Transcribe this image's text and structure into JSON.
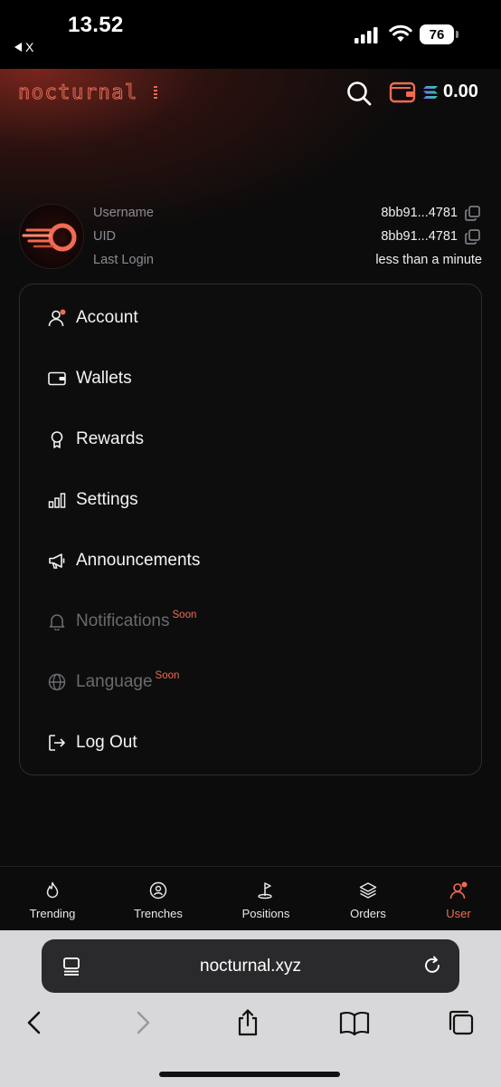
{
  "status_bar": {
    "time": "13.52",
    "back_label": "X",
    "battery": "76"
  },
  "header": {
    "logo_text": "nocturnal",
    "balance": "0.00",
    "icons": [
      "search-icon",
      "wallet-icon",
      "solana-icon"
    ]
  },
  "profile": {
    "labels": {
      "username": "Username",
      "uid": "UID",
      "last_login": "Last Login"
    },
    "values": {
      "username": "8bb91...4781",
      "uid": "8bb91...4781",
      "last_login": "less than a minute"
    }
  },
  "menu": {
    "items": [
      {
        "label": "Account",
        "icon": "user-icon",
        "badge": ""
      },
      {
        "label": "Wallets",
        "icon": "wallet-icon",
        "badge": ""
      },
      {
        "label": "Rewards",
        "icon": "award-icon",
        "badge": ""
      },
      {
        "label": "Settings",
        "icon": "bar-chart-icon",
        "badge": ""
      },
      {
        "label": "Announcements",
        "icon": "megaphone-icon",
        "badge": ""
      },
      {
        "label": "Notifications",
        "icon": "bell-icon",
        "badge": "Soon"
      },
      {
        "label": "Language",
        "icon": "globe-icon",
        "badge": "Soon"
      },
      {
        "label": "Log Out",
        "icon": "logout-icon",
        "badge": ""
      }
    ]
  },
  "bottom_nav": {
    "items": [
      {
        "label": "Trending",
        "icon": "flame-icon"
      },
      {
        "label": "Trenches",
        "icon": "smiley-icon"
      },
      {
        "label": "Positions",
        "icon": "golf-flag-icon"
      },
      {
        "label": "Orders",
        "icon": "layers-icon"
      },
      {
        "label": "User",
        "icon": "user-icon"
      }
    ],
    "active": "User"
  },
  "browser": {
    "url": "nocturnal.xyz"
  },
  "colors": {
    "accent": "#f06b52",
    "background": "#0c0c0c",
    "muted_text": "#8b8b95"
  }
}
